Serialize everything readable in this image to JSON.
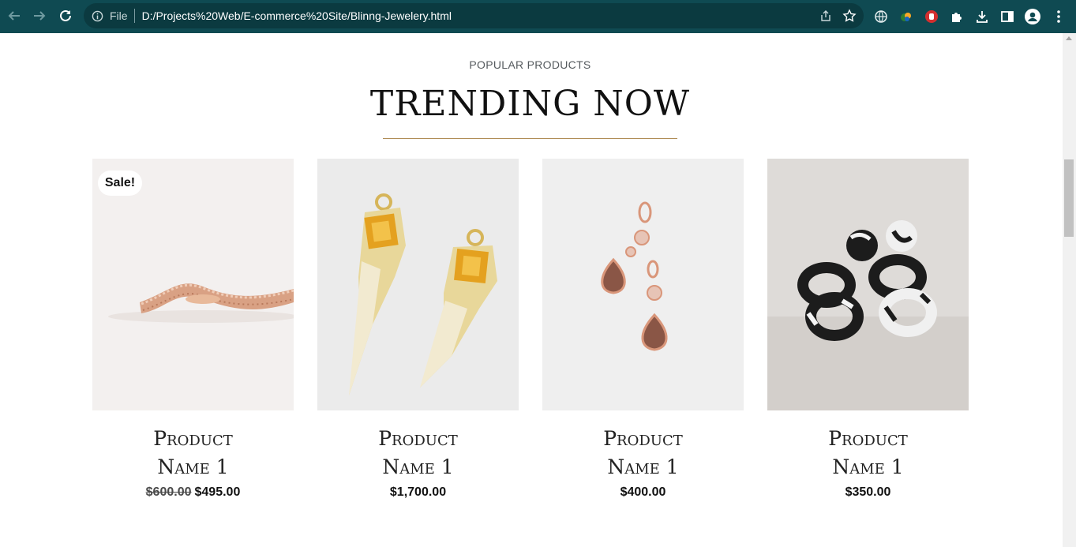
{
  "browser": {
    "file_label": "File",
    "url": "D:/Projects%20Web/E-commerce%20Site/Blinng-Jewelery.html"
  },
  "section": {
    "eyebrow": "POPULAR PRODUCTS",
    "title": "TRENDING NOW"
  },
  "products": [
    {
      "badge": "Sale!",
      "name_line1": "Product",
      "name_line2": "Name 1",
      "old_price": "$600.00",
      "price": "$495.00"
    },
    {
      "badge": "",
      "name_line1": "Product",
      "name_line2": "Name 1",
      "old_price": "",
      "price": "$1,700.00"
    },
    {
      "badge": "",
      "name_line1": "Product",
      "name_line2": "Name 1",
      "old_price": "",
      "price": "$400.00"
    },
    {
      "badge": "",
      "name_line1": "Product",
      "name_line2": "Name 1",
      "old_price": "",
      "price": "$350.00"
    }
  ],
  "colors": {
    "chrome": "#0f4a52",
    "accent_rule": "#b08d57"
  }
}
